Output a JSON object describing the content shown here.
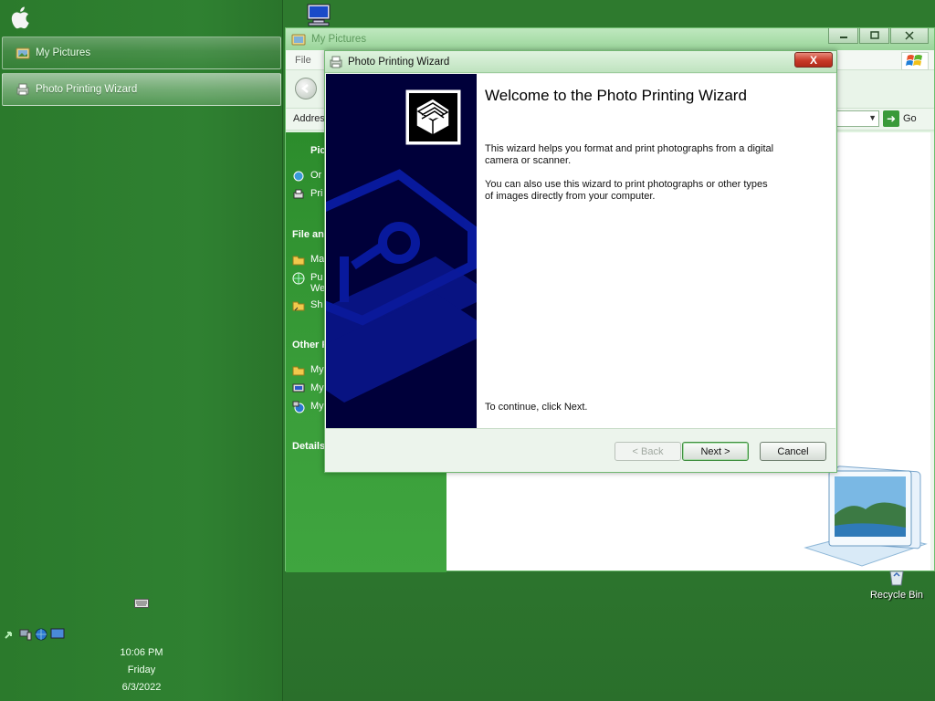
{
  "taskbar": {
    "tasks": [
      {
        "label": "My Pictures",
        "icon": "folder-pictures-icon"
      },
      {
        "label": "Photo Printing Wizard",
        "icon": "printer-wizard-icon"
      }
    ],
    "clock": {
      "time": "10:06 PM",
      "day": "Friday",
      "date": "6/3/2022"
    }
  },
  "desktop": {
    "recycle_bin_label": "Recycle Bin"
  },
  "explorer": {
    "title": "My Pictures",
    "menu_file": "File",
    "address_label": "Address",
    "go_label": "Go",
    "side": {
      "section1_title": "Pic",
      "section1_items": [
        "Or",
        "Pri"
      ],
      "section2_title": "File an",
      "section2_items": [
        "Ma",
        "Pu\nWe",
        "Sh"
      ],
      "section3_title": "Other P",
      "section3_items": [
        "My",
        "My",
        "My"
      ],
      "section4_title": "Details"
    }
  },
  "wizard": {
    "title": "Photo Printing Wizard",
    "close_label": "X",
    "heading": "Welcome to the Photo Printing Wizard",
    "para1": "This wizard helps you format and print photographs from a digital camera or scanner.",
    "para2": "You can also use this wizard to print photographs or other types of images directly from your computer.",
    "continue_text": "To continue, click Next.",
    "buttons": {
      "back": "< Back",
      "next": "Next >",
      "cancel": "Cancel"
    }
  },
  "colors": {
    "desktop_green": "#2f7a30",
    "wizard_banner": "#00003a",
    "side_panel_green": "#3a9e3a"
  }
}
